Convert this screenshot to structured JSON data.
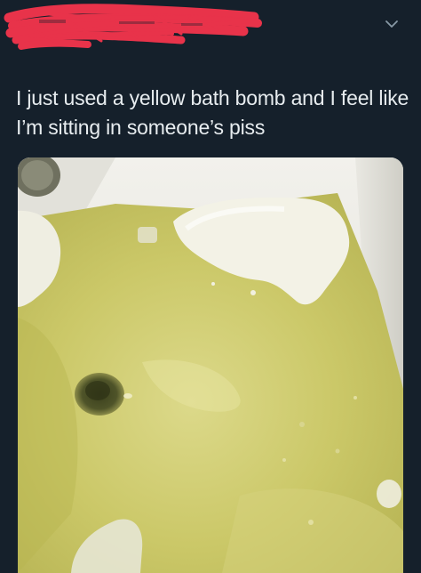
{
  "header": {
    "author_redacted": true,
    "more_icon": "chevron-down-icon"
  },
  "tweet": {
    "text": "I just used a yellow bath bomb and I feel like I’m sitting in someone’s piss"
  },
  "media": {
    "kind": "photo",
    "content": "bathtub-yellow-water",
    "colors": {
      "water": "#c9c763",
      "water_light": "#dedb8a",
      "tub": "#eae9e4",
      "foam": "#f4f3ea",
      "drain": "#4b5026"
    }
  },
  "theme": {
    "background": "#15202b",
    "text": "#e7ecef",
    "redaction": "#e8334a",
    "icon": "#8899a6"
  }
}
